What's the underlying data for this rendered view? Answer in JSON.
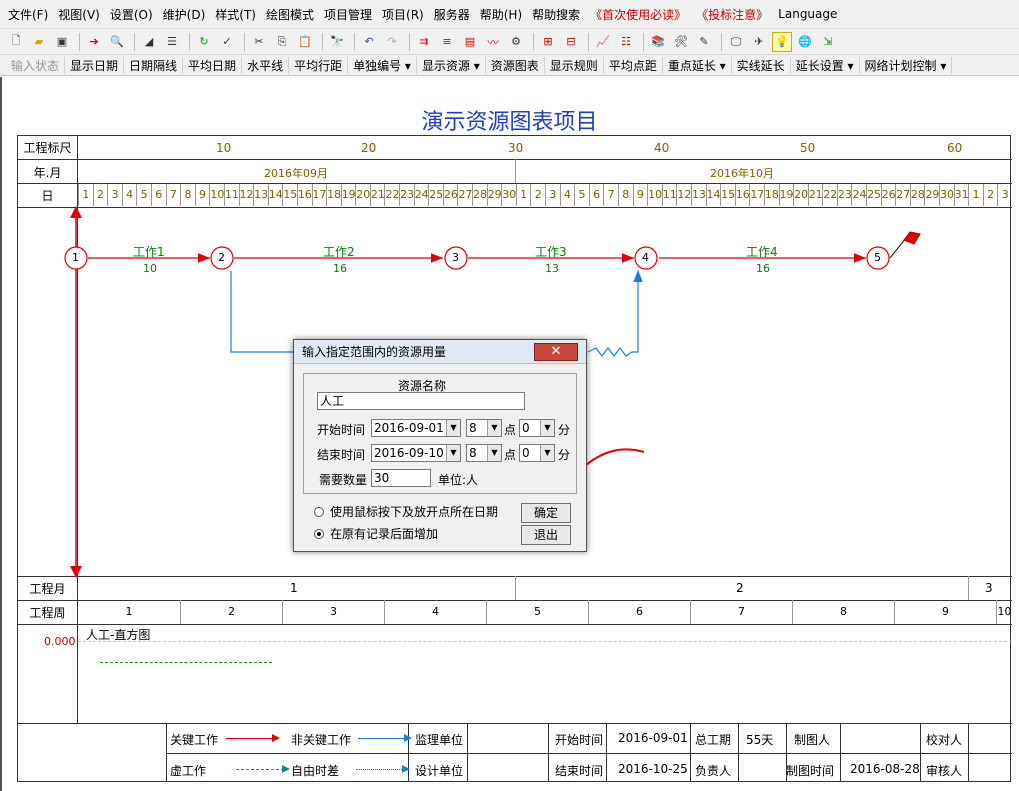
{
  "menu": [
    "文件(F)",
    "视图(V)",
    "设置(O)",
    "维护(D)",
    "样式(T)",
    "绘图模式",
    "项目管理",
    "项目(R)",
    "服务器",
    "帮助(H)",
    "帮助搜索"
  ],
  "menu_red": [
    "《首次使用必读》",
    "《投标注意》"
  ],
  "menu_lang": "Language",
  "toolbar2": [
    "输入状态",
    "显示日期",
    "日期隔线",
    "平均日期",
    "水平线",
    "平均行距",
    "单独编号 ▾",
    "显示资源 ▾",
    "资源图表",
    "显示规则",
    "平均点距",
    "重点延长 ▾",
    "实线延长",
    "延长设置 ▾",
    "网络计划控制 ▾"
  ],
  "title": "演示资源图表项目",
  "rows": {
    "ruler_label": "工程标尺",
    "ym_label": "年.月",
    "day_label": "日",
    "pm_label": "工程月",
    "pw_label": "工程周"
  },
  "ruler_ticks": [
    "10",
    "20",
    "30",
    "40",
    "50",
    "60"
  ],
  "months": [
    "2016年09月",
    "2016年10月"
  ],
  "days_sep": [
    "1",
    "2",
    "3",
    "4",
    "5",
    "6",
    "7",
    "8",
    "9",
    "10",
    "11",
    "12",
    "13",
    "14",
    "15",
    "16",
    "17",
    "18",
    "19",
    "20",
    "21",
    "22",
    "23",
    "24",
    "25",
    "26",
    "27",
    "28",
    "29",
    "30"
  ],
  "days_oct": [
    "1",
    "2",
    "3",
    "4",
    "5",
    "6",
    "7",
    "8",
    "9",
    "10",
    "11",
    "12",
    "13",
    "14",
    "15",
    "16",
    "17",
    "18",
    "19",
    "20",
    "21",
    "22",
    "23",
    "24",
    "25",
    "26",
    "27",
    "28",
    "29",
    "30",
    "31"
  ],
  "days_nov": [
    "1",
    "2",
    "3"
  ],
  "proj_months": [
    "1",
    "2",
    "3"
  ],
  "proj_weeks": [
    "1",
    "2",
    "3",
    "4",
    "5",
    "6",
    "7",
    "8",
    "9",
    "10"
  ],
  "nodes": [
    "1",
    "2",
    "3",
    "4",
    "5"
  ],
  "tasks": [
    {
      "name": "工作1",
      "duration": "10"
    },
    {
      "name": "工作2",
      "duration": "16"
    },
    {
      "name": "工作3",
      "duration": "13"
    },
    {
      "name": "工作4",
      "duration": "16"
    }
  ],
  "histogram": {
    "label": "人工-直方图",
    "value": "0.000"
  },
  "dialog": {
    "title": "输入指定范围内的资源用量",
    "close": "✕",
    "resource_label": "资源名称",
    "resource_value": "人工",
    "start_label": "开始时间",
    "start_date": "2016-09-01",
    "start_hour": "8",
    "start_min": "0",
    "end_label": "结束时间",
    "end_date": "2016-09-10",
    "end_hour": "8",
    "end_min": "0",
    "hour_unit": "点",
    "min_unit": "分",
    "qty_label": "需要数量",
    "qty_value": "30",
    "unit_label": "单位:人",
    "radio1": "使用鼠标按下及放开点所在日期",
    "radio2": "在原有记录后面增加",
    "ok": "确定",
    "cancel": "退出"
  },
  "legend": {
    "critical": "关键工作",
    "noncritical": "非关键工作",
    "supervisor": "监理单位",
    "dummy": "虚工作",
    "float": "自由时差",
    "designer": "设计单位",
    "start_label": "开始时间",
    "start_value": "2016-09-01",
    "total_label": "总工期",
    "total_value": "55天",
    "drawer_label": "制图人",
    "checker_label": "校对人",
    "end_label": "结束时间",
    "end_value": "2016-10-25",
    "owner_label": "负责人",
    "draw_time_label": "制图时间",
    "draw_time_value": "2016-08-28",
    "reviewer_label": "审核人"
  },
  "colors": {
    "critical": "#e00000",
    "noncritical": "#1e7fd8",
    "title": "#1f3fbf",
    "green": "#0a7a0a",
    "annotation": "#e00000"
  }
}
